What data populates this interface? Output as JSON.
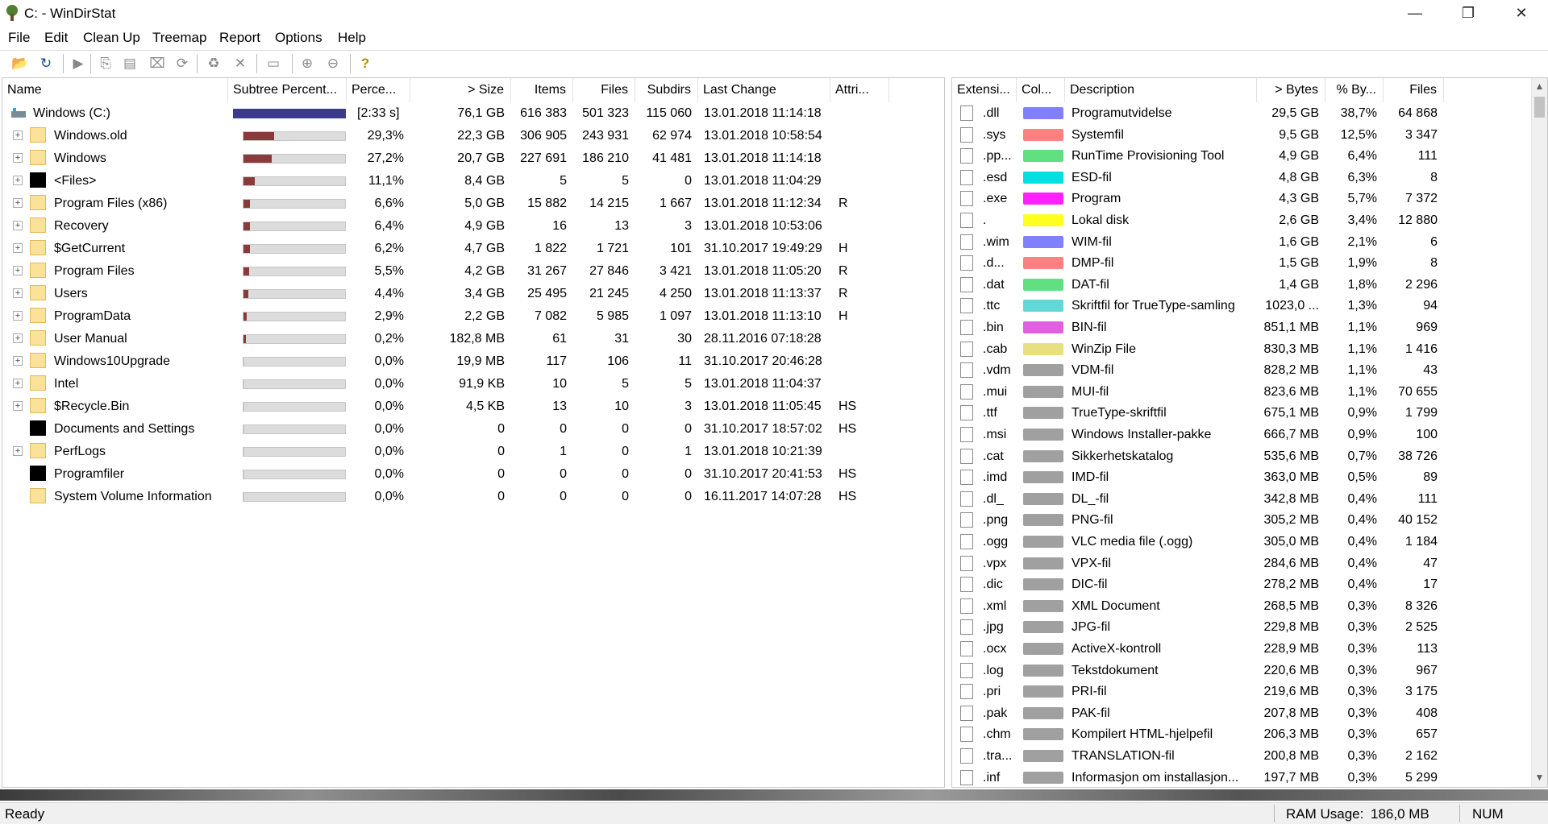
{
  "window": {
    "title": "C: - WinDirStat",
    "minimize_glyph": "—",
    "restore_glyph": "❐",
    "close_glyph": "✕"
  },
  "menu": [
    "File",
    "Edit",
    "Clean Up",
    "Treemap",
    "Report",
    "Options",
    "Help"
  ],
  "toolbar": {
    "buttons": [
      {
        "icon": "open-folder-icon",
        "glyph": "📂"
      },
      {
        "icon": "refresh-icon",
        "glyph": "↻"
      },
      {
        "icon": "play-icon",
        "glyph": "▶"
      },
      {
        "icon": "copy-path-icon",
        "glyph": "⎘"
      },
      {
        "icon": "explorer-icon",
        "glyph": "▤"
      },
      {
        "icon": "command-prompt-icon",
        "glyph": "⌧"
      },
      {
        "icon": "refresh-selected-icon",
        "glyph": "⟳"
      },
      {
        "icon": "recycle-icon",
        "glyph": "♻"
      },
      {
        "icon": "delete-icon",
        "glyph": "✕"
      },
      {
        "icon": "properties-icon",
        "glyph": "▭"
      },
      {
        "icon": "zoom-in-icon",
        "glyph": "⊕"
      },
      {
        "icon": "zoom-out-icon",
        "glyph": "⊖"
      },
      {
        "icon": "help-icon",
        "glyph": "?"
      }
    ]
  },
  "colors": {
    "subtree_bar": "#8a3a3a",
    "root_bar": "#3b3b8c",
    "folder": "#fbe29a"
  },
  "directory": {
    "columns": [
      "Name",
      "Subtree Percent...",
      "Perce...",
      "> Size",
      "Items",
      "Files",
      "Subdirs",
      "Last Change",
      "Attri..."
    ],
    "root": {
      "name": "Windows (C:)",
      "bar_text": "",
      "percent": "[2:33 s]",
      "size": "76,1 GB",
      "items": "616 383",
      "files": "501 323",
      "subdirs": "115 060",
      "last_change": "13.01.2018  11:14:18",
      "attr": ""
    },
    "rows": [
      {
        "name": "Windows.old",
        "icon": "folder",
        "expand": "+",
        "fraction": 0.293,
        "percent": "29,3%",
        "size": "22,3 GB",
        "items": "306 905",
        "files": "243 931",
        "subdirs": "62 974",
        "last_change": "13.01.2018  10:58:54",
        "attr": ""
      },
      {
        "name": "Windows",
        "icon": "folder",
        "expand": "+",
        "fraction": 0.272,
        "percent": "27,2%",
        "size": "20,7 GB",
        "items": "227 691",
        "files": "186 210",
        "subdirs": "41 481",
        "last_change": "13.01.2018  11:14:18",
        "attr": ""
      },
      {
        "name": "<Files>",
        "icon": "black",
        "expand": "+",
        "fraction": 0.111,
        "percent": "11,1%",
        "size": "8,4 GB",
        "items": "5",
        "files": "5",
        "subdirs": "0",
        "last_change": "13.01.2018  11:04:29",
        "attr": ""
      },
      {
        "name": "Program Files (x86)",
        "icon": "folder",
        "expand": "+",
        "fraction": 0.066,
        "percent": "6,6%",
        "size": "5,0 GB",
        "items": "15 882",
        "files": "14 215",
        "subdirs": "1 667",
        "last_change": "13.01.2018  11:12:34",
        "attr": "R"
      },
      {
        "name": "Recovery",
        "icon": "folder",
        "expand": "+",
        "fraction": 0.064,
        "percent": "6,4%",
        "size": "4,9 GB",
        "items": "16",
        "files": "13",
        "subdirs": "3",
        "last_change": "13.01.2018  10:53:06",
        "attr": ""
      },
      {
        "name": "$GetCurrent",
        "icon": "folder",
        "expand": "+",
        "fraction": 0.062,
        "percent": "6,2%",
        "size": "4,7 GB",
        "items": "1 822",
        "files": "1 721",
        "subdirs": "101",
        "last_change": "31.10.2017  19:49:29",
        "attr": "H"
      },
      {
        "name": "Program Files",
        "icon": "folder",
        "expand": "+",
        "fraction": 0.055,
        "percent": "5,5%",
        "size": "4,2 GB",
        "items": "31 267",
        "files": "27 846",
        "subdirs": "3 421",
        "last_change": "13.01.2018  11:05:20",
        "attr": "R"
      },
      {
        "name": "Users",
        "icon": "folder",
        "expand": "+",
        "fraction": 0.044,
        "percent": "4,4%",
        "size": "3,4 GB",
        "items": "25 495",
        "files": "21 245",
        "subdirs": "4 250",
        "last_change": "13.01.2018  11:13:37",
        "attr": "R"
      },
      {
        "name": "ProgramData",
        "icon": "folder",
        "expand": "+",
        "fraction": 0.029,
        "percent": "2,9%",
        "size": "2,2 GB",
        "items": "7 082",
        "files": "5 985",
        "subdirs": "1 097",
        "last_change": "13.01.2018  11:13:10",
        "attr": "H"
      },
      {
        "name": "User Manual",
        "icon": "folder",
        "expand": "+",
        "fraction": 0.002,
        "percent": "0,2%",
        "size": "182,8 MB",
        "items": "61",
        "files": "31",
        "subdirs": "30",
        "last_change": "28.11.2016  07:18:28",
        "attr": ""
      },
      {
        "name": "Windows10Upgrade",
        "icon": "folder",
        "expand": "+",
        "fraction": 0.0,
        "percent": "0,0%",
        "size": "19,9 MB",
        "items": "117",
        "files": "106",
        "subdirs": "11",
        "last_change": "31.10.2017  20:46:28",
        "attr": ""
      },
      {
        "name": "Intel",
        "icon": "folder",
        "expand": "+",
        "fraction": 0.0,
        "percent": "0,0%",
        "size": "91,9 KB",
        "items": "10",
        "files": "5",
        "subdirs": "5",
        "last_change": "13.01.2018  11:04:37",
        "attr": ""
      },
      {
        "name": "$Recycle.Bin",
        "icon": "folder",
        "expand": "+",
        "fraction": 0.0,
        "percent": "0,0%",
        "size": "4,5 KB",
        "items": "13",
        "files": "10",
        "subdirs": "3",
        "last_change": "13.01.2018  11:05:45",
        "attr": "HS"
      },
      {
        "name": "Documents and Settings",
        "icon": "black",
        "expand": "",
        "fraction": 0.0,
        "percent": "0,0%",
        "size": "0",
        "items": "0",
        "files": "0",
        "subdirs": "0",
        "last_change": "31.10.2017  18:57:02",
        "attr": "HS"
      },
      {
        "name": "PerfLogs",
        "icon": "folder",
        "expand": "+",
        "fraction": 0.0,
        "percent": "0,0%",
        "size": "0",
        "items": "1",
        "files": "0",
        "subdirs": "1",
        "last_change": "13.01.2018  10:21:39",
        "attr": ""
      },
      {
        "name": "Programfiler",
        "icon": "black",
        "expand": "",
        "fraction": 0.0,
        "percent": "0,0%",
        "size": "0",
        "items": "0",
        "files": "0",
        "subdirs": "0",
        "last_change": "31.10.2017  20:41:53",
        "attr": "HS"
      },
      {
        "name": "System Volume Information",
        "icon": "folder",
        "expand": "",
        "fraction": 0.0,
        "percent": "0,0%",
        "size": "0",
        "items": "0",
        "files": "0",
        "subdirs": "0",
        "last_change": "16.11.2017  14:07:28",
        "attr": "HS"
      }
    ]
  },
  "extensions": {
    "columns": [
      "Extensi...",
      "Col...",
      "Description",
      "> Bytes",
      "% By...",
      "Files"
    ],
    "rows": [
      {
        "ext": ".dll",
        "color": "#8080ff",
        "desc": "Programutvidelse",
        "bytes": "29,5 GB",
        "pct": "38,7%",
        "files": "64 868"
      },
      {
        "ext": ".sys",
        "color": "#ff8080",
        "desc": "Systemfil",
        "bytes": "9,5 GB",
        "pct": "12,5%",
        "files": "3 347"
      },
      {
        "ext": ".pp...",
        "color": "#60e080",
        "desc": "RunTime Provisioning Tool",
        "bytes": "4,9 GB",
        "pct": "6,4%",
        "files": "111"
      },
      {
        "ext": ".esd",
        "color": "#00e0e0",
        "desc": "ESD-fil",
        "bytes": "4,8 GB",
        "pct": "6,3%",
        "files": "8"
      },
      {
        "ext": ".exe",
        "color": "#ff20ff",
        "desc": "Program",
        "bytes": "4,3 GB",
        "pct": "5,7%",
        "files": "7 372"
      },
      {
        "ext": ".",
        "color": "#ffff20",
        "desc": "Lokal disk",
        "bytes": "2,6 GB",
        "pct": "3,4%",
        "files": "12 880"
      },
      {
        "ext": ".wim",
        "color": "#8080ff",
        "desc": "WIM-fil",
        "bytes": "1,6 GB",
        "pct": "2,1%",
        "files": "6"
      },
      {
        "ext": ".d...",
        "color": "#ff8080",
        "desc": "DMP-fil",
        "bytes": "1,5 GB",
        "pct": "1,9%",
        "files": "8"
      },
      {
        "ext": ".dat",
        "color": "#60e080",
        "desc": "DAT-fil",
        "bytes": "1,4 GB",
        "pct": "1,8%",
        "files": "2 296"
      },
      {
        "ext": ".ttc",
        "color": "#60d8d8",
        "desc": "Skriftfil for TrueType-samling",
        "bytes": "1023,0 ...",
        "pct": "1,3%",
        "files": "94"
      },
      {
        "ext": ".bin",
        "color": "#e060e0",
        "desc": "BIN-fil",
        "bytes": "851,1 MB",
        "pct": "1,1%",
        "files": "969"
      },
      {
        "ext": ".cab",
        "color": "#e8e080",
        "desc": "WinZip File",
        "bytes": "830,3 MB",
        "pct": "1,1%",
        "files": "1 416"
      },
      {
        "ext": ".vdm",
        "color": "#a0a0a0",
        "desc": "VDM-fil",
        "bytes": "828,2 MB",
        "pct": "1,1%",
        "files": "43"
      },
      {
        "ext": ".mui",
        "color": "#a0a0a0",
        "desc": "MUI-fil",
        "bytes": "823,6 MB",
        "pct": "1,1%",
        "files": "70 655"
      },
      {
        "ext": ".ttf",
        "color": "#a0a0a0",
        "desc": "TrueType-skriftfil",
        "bytes": "675,1 MB",
        "pct": "0,9%",
        "files": "1 799"
      },
      {
        "ext": ".msi",
        "color": "#a0a0a0",
        "desc": "Windows Installer-pakke",
        "bytes": "666,7 MB",
        "pct": "0,9%",
        "files": "100"
      },
      {
        "ext": ".cat",
        "color": "#a0a0a0",
        "desc": "Sikkerhetskatalog",
        "bytes": "535,6 MB",
        "pct": "0,7%",
        "files": "38 726"
      },
      {
        "ext": ".imd",
        "color": "#a0a0a0",
        "desc": "IMD-fil",
        "bytes": "363,0 MB",
        "pct": "0,5%",
        "files": "89"
      },
      {
        "ext": ".dl_",
        "color": "#a0a0a0",
        "desc": "DL_-fil",
        "bytes": "342,8 MB",
        "pct": "0,4%",
        "files": "111"
      },
      {
        "ext": ".png",
        "color": "#a0a0a0",
        "desc": "PNG-fil",
        "bytes": "305,2 MB",
        "pct": "0,4%",
        "files": "40 152"
      },
      {
        "ext": ".ogg",
        "color": "#a0a0a0",
        "desc": "VLC media file (.ogg)",
        "bytes": "305,0 MB",
        "pct": "0,4%",
        "files": "1 184"
      },
      {
        "ext": ".vpx",
        "color": "#a0a0a0",
        "desc": "VPX-fil",
        "bytes": "284,6 MB",
        "pct": "0,4%",
        "files": "47"
      },
      {
        "ext": ".dic",
        "color": "#a0a0a0",
        "desc": "DIC-fil",
        "bytes": "278,2 MB",
        "pct": "0,4%",
        "files": "17"
      },
      {
        "ext": ".xml",
        "color": "#a0a0a0",
        "desc": "XML Document",
        "bytes": "268,5 MB",
        "pct": "0,3%",
        "files": "8 326"
      },
      {
        "ext": ".jpg",
        "color": "#a0a0a0",
        "desc": "JPG-fil",
        "bytes": "229,8 MB",
        "pct": "0,3%",
        "files": "2 525"
      },
      {
        "ext": ".ocx",
        "color": "#a0a0a0",
        "desc": "ActiveX-kontroll",
        "bytes": "228,9 MB",
        "pct": "0,3%",
        "files": "113"
      },
      {
        "ext": ".log",
        "color": "#a0a0a0",
        "desc": "Tekstdokument",
        "bytes": "220,6 MB",
        "pct": "0,3%",
        "files": "967"
      },
      {
        "ext": ".pri",
        "color": "#a0a0a0",
        "desc": "PRI-fil",
        "bytes": "219,6 MB",
        "pct": "0,3%",
        "files": "3 175"
      },
      {
        "ext": ".pak",
        "color": "#a0a0a0",
        "desc": "PAK-fil",
        "bytes": "207,8 MB",
        "pct": "0,3%",
        "files": "408"
      },
      {
        "ext": ".chm",
        "color": "#a0a0a0",
        "desc": "Kompilert HTML-hjelpefil",
        "bytes": "206,3 MB",
        "pct": "0,3%",
        "files": "657"
      },
      {
        "ext": ".tra...",
        "color": "#a0a0a0",
        "desc": "TRANSLATION-fil",
        "bytes": "200,8 MB",
        "pct": "0,3%",
        "files": "2 162"
      },
      {
        "ext": ".inf",
        "color": "#a0a0a0",
        "desc": "Informasjon om installasjon...",
        "bytes": "197,7 MB",
        "pct": "0,3%",
        "files": "5 299"
      }
    ]
  },
  "status": {
    "text": "Ready",
    "ram_label": "RAM Usage:",
    "ram_value": "186,0 MB",
    "num": "NUM"
  }
}
